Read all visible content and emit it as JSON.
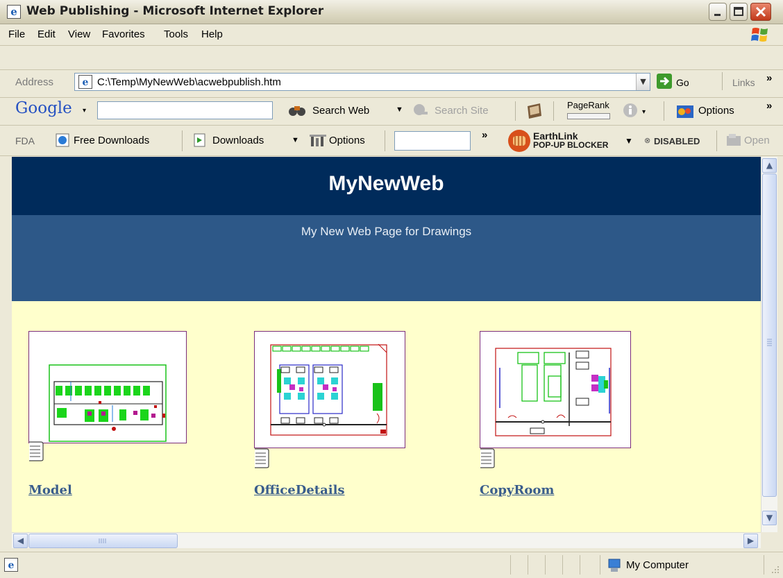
{
  "window": {
    "title": "Web Publishing - Microsoft Internet Explorer"
  },
  "menu": [
    "File",
    "Edit",
    "View",
    "Favorites",
    "Tools",
    "Help"
  ],
  "address_bar": {
    "label": "Address",
    "url": "C:\\Temp\\MyNewWeb\\acwebpublish.htm",
    "go_label": "Go",
    "links_label": "Links",
    "overflow": "»"
  },
  "google_toolbar": {
    "logo": "Google",
    "search_value": "",
    "search_web": "Search Web",
    "search_site": "Search Site",
    "pagerank": "PageRank",
    "options": "Options",
    "overflow": "»"
  },
  "fda_toolbar": {
    "fda": "FDA",
    "free_downloads": "Free Downloads",
    "downloads": "Downloads",
    "options": "Options",
    "overflow": "»",
    "earthlink_line1": "EarthLink",
    "earthlink_line2": "POP-UP BLOCKER",
    "disabled": "DISABLED",
    "open": "Open"
  },
  "page": {
    "title": "MyNewWeb",
    "subtitle": "My New Web Page for Drawings",
    "drawings": [
      {
        "label": "Model"
      },
      {
        "label": "OfficeDetails"
      },
      {
        "label": "CopyRoom"
      }
    ]
  },
  "status_bar": {
    "zone": "My Computer"
  },
  "colors": {
    "header_dark": "#002b5b",
    "header_mid": "#2d5888",
    "page_bg": "#ffffcc",
    "link": "#3a5d8c",
    "thumb_border": "#7b2d7b"
  }
}
